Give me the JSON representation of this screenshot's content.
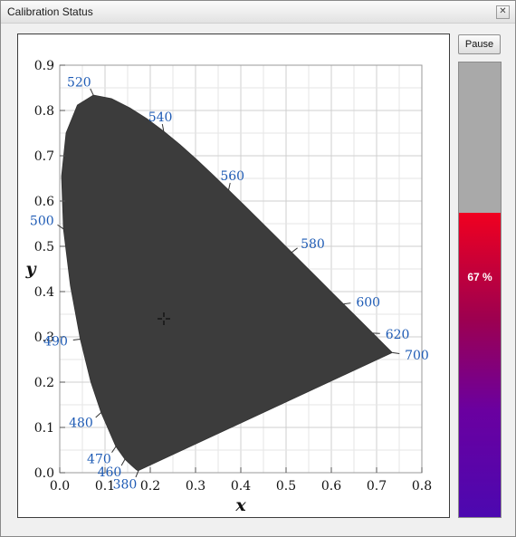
{
  "window": {
    "title": "Calibration Status",
    "close_icon": "close-icon"
  },
  "toolbar": {
    "pause_label": "Pause"
  },
  "progress": {
    "value_percent": 67,
    "label": "67 %"
  },
  "chart_data": {
    "type": "scatter",
    "xlabel": "x",
    "ylabel": "y",
    "xlim": [
      0.0,
      0.8
    ],
    "ylim": [
      0.0,
      0.9
    ],
    "grid": true,
    "x_ticks": [
      "0.0",
      "0.1",
      "0.2",
      "0.3",
      "0.4",
      "0.5",
      "0.6",
      "0.7",
      "0.8"
    ],
    "y_ticks": [
      "0.0",
      "0.1",
      "0.2",
      "0.3",
      "0.4",
      "0.5",
      "0.6",
      "0.7",
      "0.8",
      "0.9"
    ],
    "wavelength_labels": [
      {
        "text": "380",
        "x": 0.1741,
        "y": 0.005
      },
      {
        "text": "460",
        "x": 0.144,
        "y": 0.0297
      },
      {
        "text": "470",
        "x": 0.1241,
        "y": 0.0578
      },
      {
        "text": "480",
        "x": 0.0913,
        "y": 0.1327
      },
      {
        "text": "490",
        "x": 0.0454,
        "y": 0.295
      },
      {
        "text": "500",
        "x": 0.0082,
        "y": 0.5384
      },
      {
        "text": "520",
        "x": 0.0743,
        "y": 0.8338
      },
      {
        "text": "540",
        "x": 0.2296,
        "y": 0.7543
      },
      {
        "text": "560",
        "x": 0.3731,
        "y": 0.6245
      },
      {
        "text": "580",
        "x": 0.5125,
        "y": 0.4866
      },
      {
        "text": "600",
        "x": 0.627,
        "y": 0.3725
      },
      {
        "text": "620",
        "x": 0.6915,
        "y": 0.3083
      },
      {
        "text": "700",
        "x": 0.7347,
        "y": 0.2653
      }
    ],
    "crosshair_marker": {
      "x": 0.23,
      "y": 0.34
    }
  }
}
